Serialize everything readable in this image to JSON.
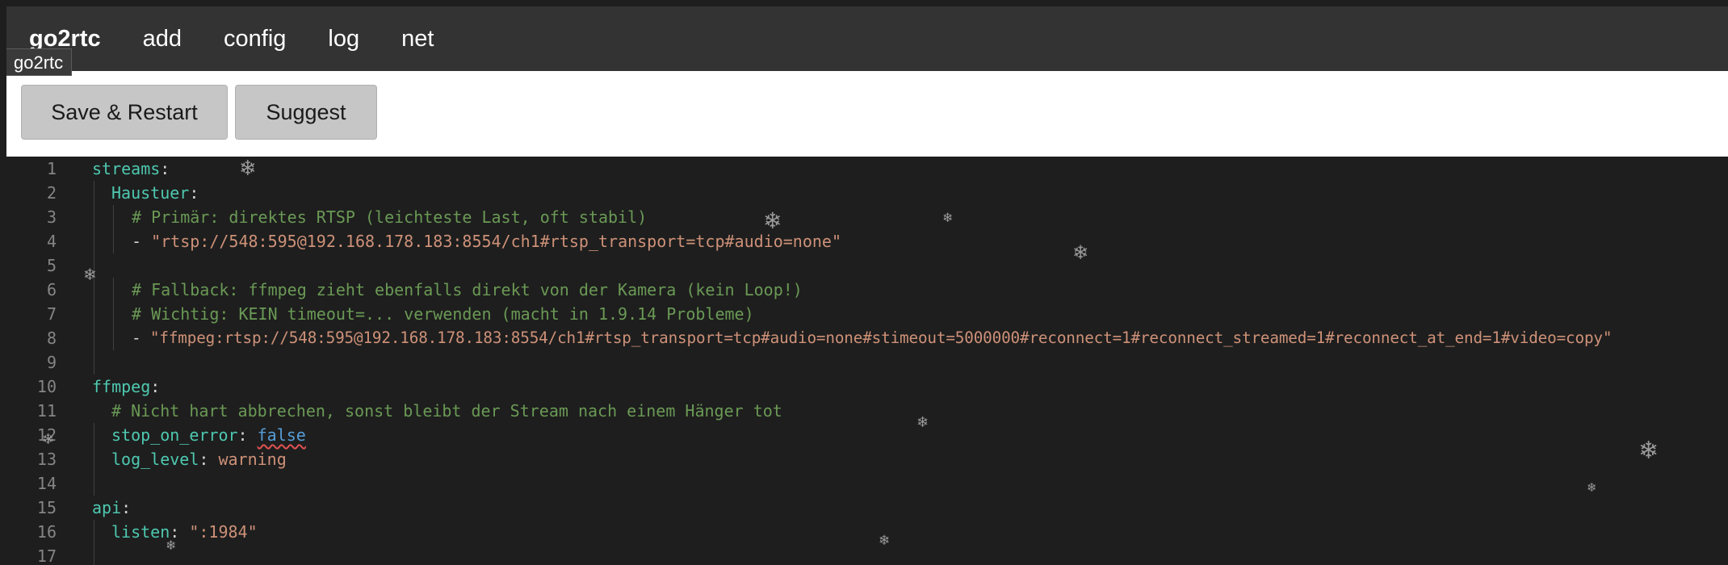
{
  "nav": {
    "brand": "go2rtc",
    "items": [
      "add",
      "config",
      "log",
      "net"
    ]
  },
  "tooltip": "go2rtc",
  "toolbar": {
    "save_label": "Save & Restart",
    "suggest_label": "Suggest"
  },
  "editor": {
    "line_numbers": [
      "1",
      "2",
      "3",
      "4",
      "5",
      "6",
      "7",
      "8",
      "9",
      "10",
      "11",
      "12",
      "13",
      "14",
      "15",
      "16",
      "17"
    ],
    "lines": [
      {
        "key": "streams",
        "colon": ":"
      },
      {
        "key": "Haustuer",
        "colon": ":"
      },
      {
        "comment": "# Primär: direktes RTSP (leichteste Last, oft stabil)"
      },
      {
        "dash": "- ",
        "string": "\"rtsp://548:595@192.168.178.183:8554/ch1#rtsp_transport=tcp#audio=none\""
      },
      {},
      {
        "comment": "# Fallback: ffmpeg zieht ebenfalls direkt von der Kamera (kein Loop!)"
      },
      {
        "comment": "# Wichtig: KEIN timeout=... verwenden (macht in 1.9.14 Probleme)"
      },
      {
        "dash": "- ",
        "string": "\"ffmpeg:rtsp://548:595@192.168.178.183:8554/ch1#rtsp_transport=tcp#audio=none#stimeout=5000000#reconnect=1#reconnect_streamed=1#reconnect_at_end=1#video=copy\""
      },
      {},
      {
        "key": "ffmpeg",
        "colon": ":"
      },
      {
        "comment": "# Nicht hart abbrechen, sonst bleibt der Stream nach einem Hänger tot"
      },
      {
        "key": "stop_on_error",
        "colon": ": ",
        "value": "false"
      },
      {
        "key": "log_level",
        "colon": ": ",
        "value": "warning"
      },
      {},
      {
        "key": "api",
        "colon": ":"
      },
      {
        "key": "listen",
        "colon": ": ",
        "value": "\":1984\""
      },
      {}
    ]
  },
  "decor": {
    "snowflake_icon": "❄"
  }
}
